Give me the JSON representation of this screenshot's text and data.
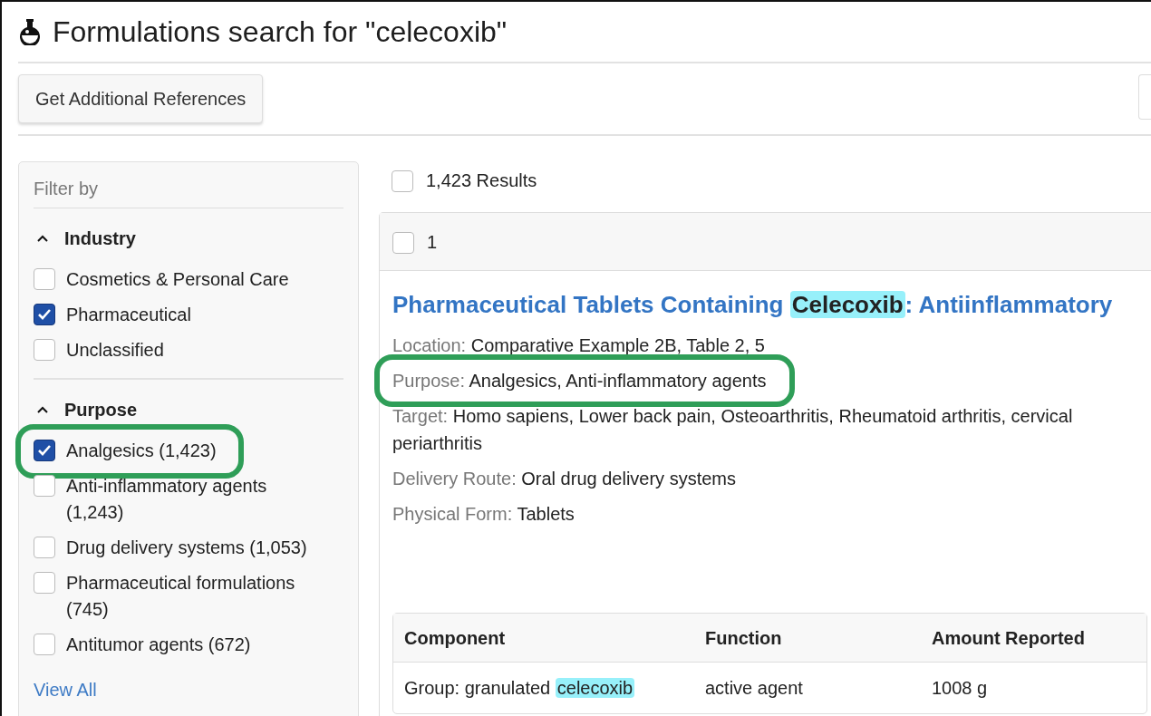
{
  "page": {
    "title": "Formulations search for \"celecoxib\""
  },
  "toolbar": {
    "buttons": [
      "Get Additional References"
    ]
  },
  "filters": {
    "heading": "Filter by",
    "groups": [
      {
        "title": "Industry",
        "expanded": true,
        "options": [
          {
            "label": "Cosmetics & Personal Care",
            "checked": false,
            "circled": false
          },
          {
            "label": "Pharmaceutical",
            "checked": true,
            "circled": false
          },
          {
            "label": "Unclassified",
            "checked": false,
            "circled": false
          }
        ]
      },
      {
        "title": "Purpose",
        "expanded": true,
        "options": [
          {
            "label": "Analgesics (1,423)",
            "checked": true,
            "circled": true
          },
          {
            "label": "Anti-inflammatory agents (1,243)",
            "checked": false,
            "circled": false
          },
          {
            "label": "Drug delivery systems (1,053)",
            "checked": false,
            "circled": false
          },
          {
            "label": "Pharmaceutical formulations (745)",
            "checked": false,
            "circled": false
          },
          {
            "label": "Antitumor agents (672)",
            "checked": false,
            "circled": false
          }
        ],
        "more_link": "View All"
      }
    ]
  },
  "results": {
    "select_all": {
      "label": "1,423 Results",
      "checked": false
    },
    "items": [
      {
        "index": "1",
        "checked": false,
        "title": [
          {
            "text": "Pharmaceutical Tablets Containing ",
            "highlight": false
          },
          {
            "text": "Celecoxib",
            "highlight": true
          },
          {
            "text": ": Antiinflammatory",
            "highlight": false
          }
        ],
        "fields": [
          {
            "label": "Location:",
            "value": "Comparative Example 2B, Table 2, 5",
            "circled": false
          },
          {
            "label": "Purpose:",
            "value": "Analgesics, Anti-inflammatory agents",
            "circled": true
          },
          {
            "label": "Target:",
            "value": "Homo sapiens, Lower back pain, Osteoarthritis, Rheumatoid arthritis, cervical periarthritis",
            "circled": false
          },
          {
            "label": "Delivery Route:",
            "value": "Oral drug delivery systems",
            "circled": false
          },
          {
            "label": "Physical Form:",
            "value": "Tablets",
            "circled": false
          }
        ],
        "table": {
          "columns": [
            "Component",
            "Function",
            "Amount Reported"
          ],
          "rows": [
            [
              [
                {
                  "text": "Group: granulated ",
                  "highlight": false
                },
                {
                  "text": "celecoxib",
                  "highlight": true
                }
              ],
              [
                {
                  "text": "active agent",
                  "highlight": false
                }
              ],
              [
                {
                  "text": "1008 g",
                  "highlight": false
                }
              ]
            ]
          ]
        }
      }
    ]
  }
}
